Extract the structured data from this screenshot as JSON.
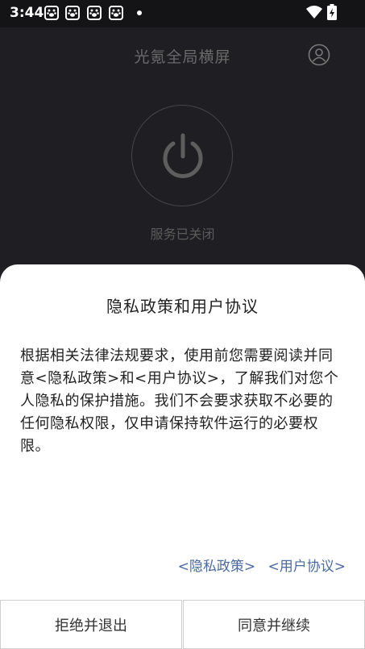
{
  "status_bar": {
    "time": "3:44",
    "notification_icons": [
      "paw-notification-icon",
      "paw-notification-icon",
      "paw-notification-icon",
      "paw-notification-icon"
    ],
    "icons": [
      "wifi-icon",
      "battery-charging-icon"
    ]
  },
  "app": {
    "title": "光氪全局横屏",
    "service_status": "服务已关闭"
  },
  "dialog": {
    "title": "隐私政策和用户协议",
    "body": "根据相关法律法规要求，使用前您需要阅读并同意<隐私政策>和<用户协议>，了解我们对您个人隐私的保护措施。我们不会要求获取不必要的任何隐私权限，仅申请保持软件运行的必要权限。",
    "privacy_link": "<隐私政策>",
    "terms_link": "<用户协议>",
    "reject_label": "拒绝并退出",
    "agree_label": "同意并继续"
  },
  "colors": {
    "background": "#1f1f23",
    "link": "#4a6aa0",
    "sheet": "#ffffff"
  }
}
